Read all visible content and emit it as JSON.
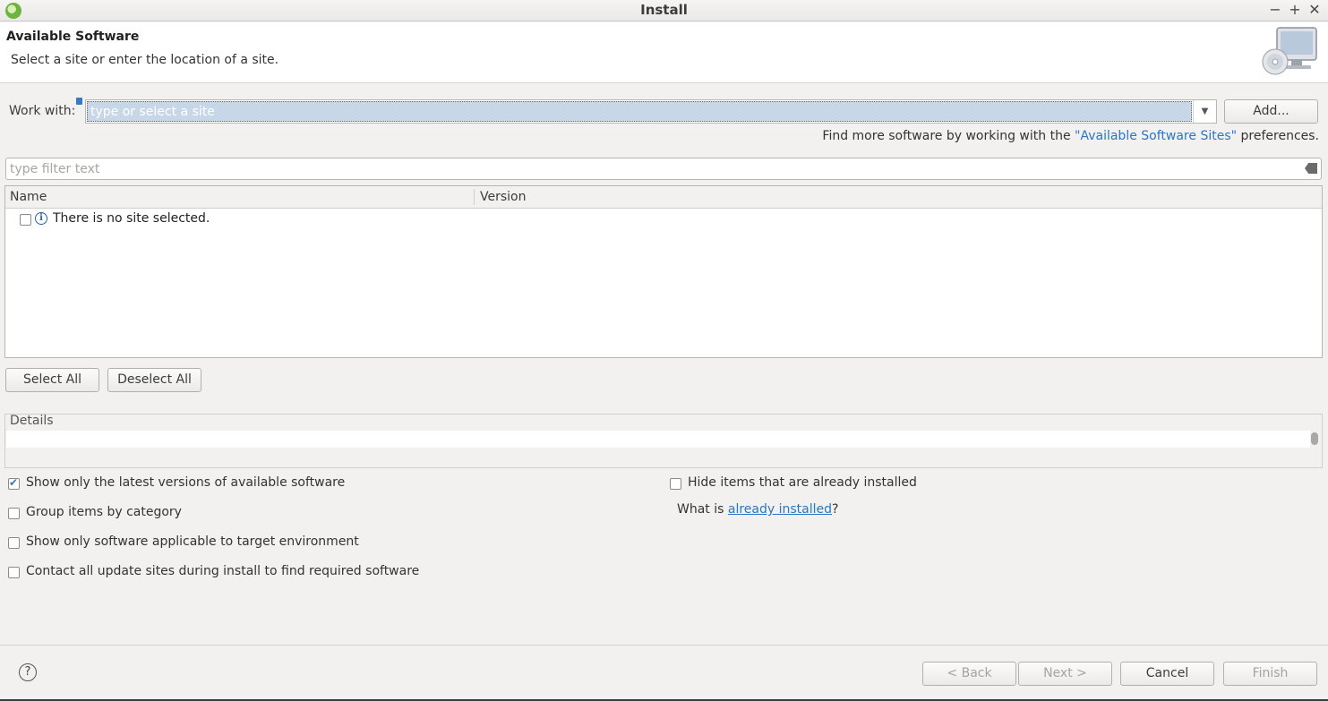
{
  "window": {
    "title": "Install",
    "controls": {
      "minimize": "−",
      "maximize": "+",
      "close": "✕"
    }
  },
  "banner": {
    "title": "Available Software",
    "subtitle": "Select a site or enter the location of a site."
  },
  "work_with": {
    "label": "Work with:",
    "placeholder": "type or select a site",
    "value": "",
    "dropdown_arrow": "▼",
    "add_button": "Add..."
  },
  "find_more": {
    "prefix": "Find more software by working with the ",
    "link": "\"Available Software Sites\"",
    "suffix": " preferences."
  },
  "filter": {
    "placeholder": "type filter text",
    "clear_icon": "⌫"
  },
  "table": {
    "columns": [
      "Name",
      "Version"
    ],
    "rows": [
      {
        "checked": false,
        "icon": "info-icon",
        "name": "There is no site selected.",
        "version": ""
      }
    ]
  },
  "selection_buttons": {
    "select_all": "Select All",
    "deselect_all": "Deselect All"
  },
  "details": {
    "label": "Details",
    "text": ""
  },
  "options": {
    "latest_versions": {
      "label": "Show only the latest versions of available software",
      "checked": true
    },
    "group_by_category": {
      "label": "Group items by category",
      "checked": false
    },
    "target_environment": {
      "label": "Show only software applicable to target environment",
      "checked": false
    },
    "contact_all_sites": {
      "label": "Contact all update sites during install to find required software",
      "checked": false
    },
    "hide_installed": {
      "label": "Hide items that are already installed",
      "checked": false
    },
    "what_is": {
      "prefix": "What is ",
      "link": "already installed",
      "suffix": "?"
    }
  },
  "footer": {
    "help": "?",
    "back": "< Back",
    "next": "Next >",
    "cancel": "Cancel",
    "finish": "Finish",
    "back_enabled": false,
    "next_enabled": false,
    "finish_enabled": false
  },
  "colors": {
    "accent": "#2a76c6",
    "dialog_bg": "#f2f1f0",
    "selection_bg": "#c8d7e8"
  }
}
